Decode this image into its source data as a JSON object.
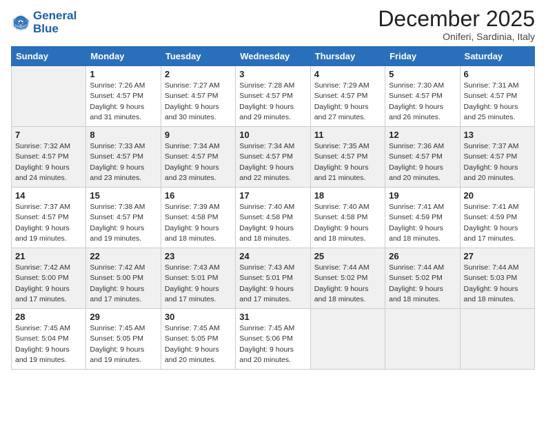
{
  "header": {
    "logo_line1": "General",
    "logo_line2": "Blue",
    "month_title": "December 2025",
    "subtitle": "Oniferi, Sardinia, Italy"
  },
  "weekdays": [
    "Sunday",
    "Monday",
    "Tuesday",
    "Wednesday",
    "Thursday",
    "Friday",
    "Saturday"
  ],
  "weeks": [
    [
      {
        "day": "",
        "info": ""
      },
      {
        "day": "1",
        "info": "Sunrise: 7:26 AM\nSunset: 4:57 PM\nDaylight: 9 hours\nand 31 minutes."
      },
      {
        "day": "2",
        "info": "Sunrise: 7:27 AM\nSunset: 4:57 PM\nDaylight: 9 hours\nand 30 minutes."
      },
      {
        "day": "3",
        "info": "Sunrise: 7:28 AM\nSunset: 4:57 PM\nDaylight: 9 hours\nand 29 minutes."
      },
      {
        "day": "4",
        "info": "Sunrise: 7:29 AM\nSunset: 4:57 PM\nDaylight: 9 hours\nand 27 minutes."
      },
      {
        "day": "5",
        "info": "Sunrise: 7:30 AM\nSunset: 4:57 PM\nDaylight: 9 hours\nand 26 minutes."
      },
      {
        "day": "6",
        "info": "Sunrise: 7:31 AM\nSunset: 4:57 PM\nDaylight: 9 hours\nand 25 minutes."
      }
    ],
    [
      {
        "day": "7",
        "info": "Sunrise: 7:32 AM\nSunset: 4:57 PM\nDaylight: 9 hours\nand 24 minutes."
      },
      {
        "day": "8",
        "info": "Sunrise: 7:33 AM\nSunset: 4:57 PM\nDaylight: 9 hours\nand 23 minutes."
      },
      {
        "day": "9",
        "info": "Sunrise: 7:34 AM\nSunset: 4:57 PM\nDaylight: 9 hours\nand 23 minutes."
      },
      {
        "day": "10",
        "info": "Sunrise: 7:34 AM\nSunset: 4:57 PM\nDaylight: 9 hours\nand 22 minutes."
      },
      {
        "day": "11",
        "info": "Sunrise: 7:35 AM\nSunset: 4:57 PM\nDaylight: 9 hours\nand 21 minutes."
      },
      {
        "day": "12",
        "info": "Sunrise: 7:36 AM\nSunset: 4:57 PM\nDaylight: 9 hours\nand 20 minutes."
      },
      {
        "day": "13",
        "info": "Sunrise: 7:37 AM\nSunset: 4:57 PM\nDaylight: 9 hours\nand 20 minutes."
      }
    ],
    [
      {
        "day": "14",
        "info": "Sunrise: 7:37 AM\nSunset: 4:57 PM\nDaylight: 9 hours\nand 19 minutes."
      },
      {
        "day": "15",
        "info": "Sunrise: 7:38 AM\nSunset: 4:57 PM\nDaylight: 9 hours\nand 19 minutes."
      },
      {
        "day": "16",
        "info": "Sunrise: 7:39 AM\nSunset: 4:58 PM\nDaylight: 9 hours\nand 18 minutes."
      },
      {
        "day": "17",
        "info": "Sunrise: 7:40 AM\nSunset: 4:58 PM\nDaylight: 9 hours\nand 18 minutes."
      },
      {
        "day": "18",
        "info": "Sunrise: 7:40 AM\nSunset: 4:58 PM\nDaylight: 9 hours\nand 18 minutes."
      },
      {
        "day": "19",
        "info": "Sunrise: 7:41 AM\nSunset: 4:59 PM\nDaylight: 9 hours\nand 18 minutes."
      },
      {
        "day": "20",
        "info": "Sunrise: 7:41 AM\nSunset: 4:59 PM\nDaylight: 9 hours\nand 17 minutes."
      }
    ],
    [
      {
        "day": "21",
        "info": "Sunrise: 7:42 AM\nSunset: 5:00 PM\nDaylight: 9 hours\nand 17 minutes."
      },
      {
        "day": "22",
        "info": "Sunrise: 7:42 AM\nSunset: 5:00 PM\nDaylight: 9 hours\nand 17 minutes."
      },
      {
        "day": "23",
        "info": "Sunrise: 7:43 AM\nSunset: 5:01 PM\nDaylight: 9 hours\nand 17 minutes."
      },
      {
        "day": "24",
        "info": "Sunrise: 7:43 AM\nSunset: 5:01 PM\nDaylight: 9 hours\nand 17 minutes."
      },
      {
        "day": "25",
        "info": "Sunrise: 7:44 AM\nSunset: 5:02 PM\nDaylight: 9 hours\nand 18 minutes."
      },
      {
        "day": "26",
        "info": "Sunrise: 7:44 AM\nSunset: 5:02 PM\nDaylight: 9 hours\nand 18 minutes."
      },
      {
        "day": "27",
        "info": "Sunrise: 7:44 AM\nSunset: 5:03 PM\nDaylight: 9 hours\nand 18 minutes."
      }
    ],
    [
      {
        "day": "28",
        "info": "Sunrise: 7:45 AM\nSunset: 5:04 PM\nDaylight: 9 hours\nand 19 minutes."
      },
      {
        "day": "29",
        "info": "Sunrise: 7:45 AM\nSunset: 5:05 PM\nDaylight: 9 hours\nand 19 minutes."
      },
      {
        "day": "30",
        "info": "Sunrise: 7:45 AM\nSunset: 5:05 PM\nDaylight: 9 hours\nand 20 minutes."
      },
      {
        "day": "31",
        "info": "Sunrise: 7:45 AM\nSunset: 5:06 PM\nDaylight: 9 hours\nand 20 minutes."
      },
      {
        "day": "",
        "info": ""
      },
      {
        "day": "",
        "info": ""
      },
      {
        "day": "",
        "info": ""
      }
    ]
  ]
}
